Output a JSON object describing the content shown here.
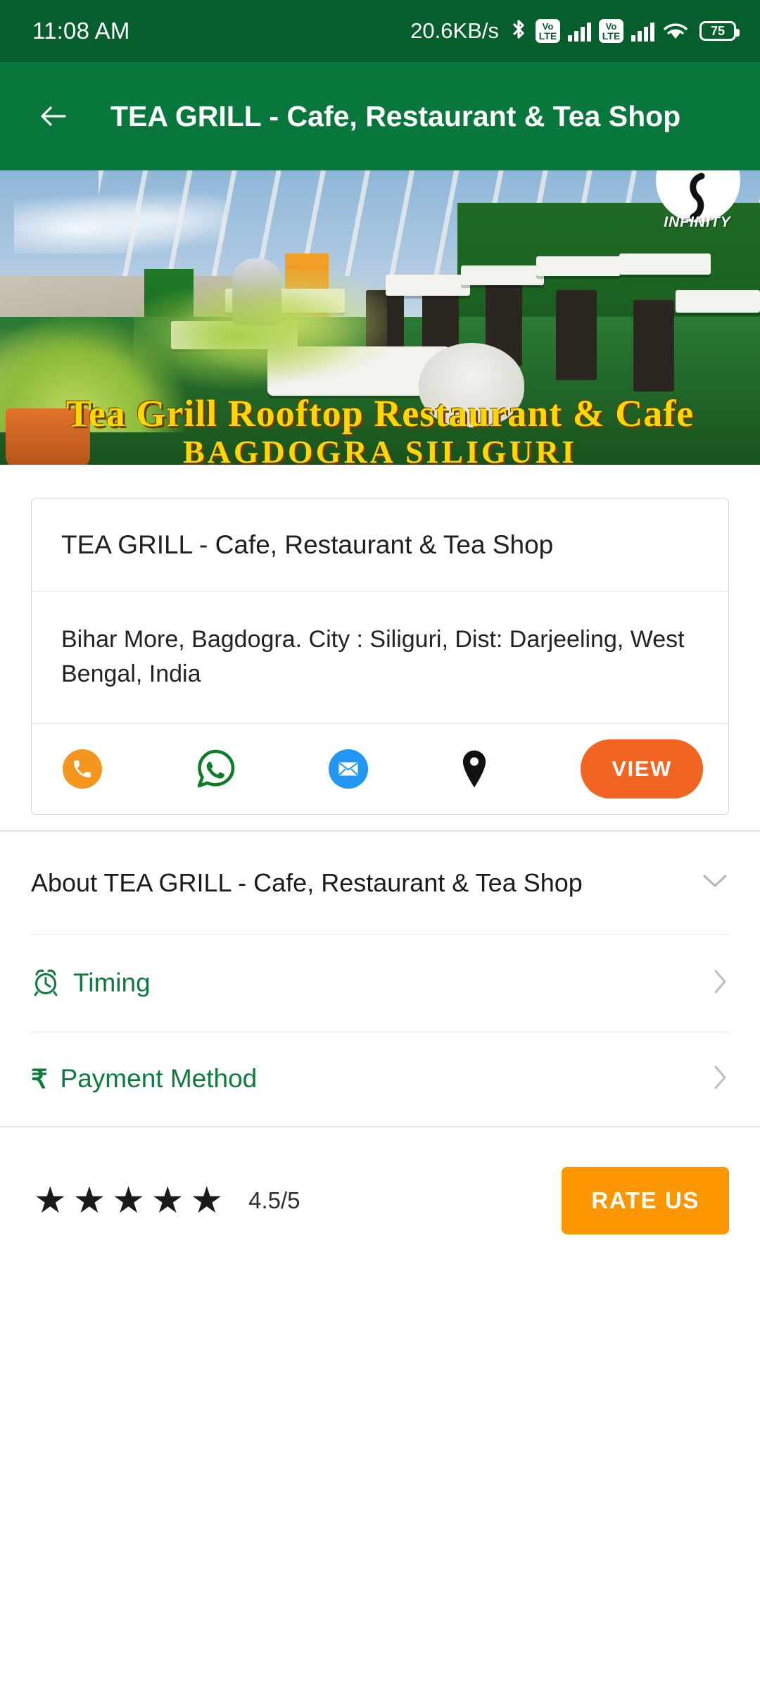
{
  "statusbar": {
    "time": "11:08 AM",
    "network_speed": "20.6KB/s",
    "volte_top": "Vo",
    "volte_bottom": "LTE",
    "battery_level": "75"
  },
  "appbar": {
    "back_label": "Back",
    "title": "TEA GRILL - Cafe, Restaurant & Tea Shop"
  },
  "banner": {
    "headline": "Tea Grill Rooftop Restaurant & Cafe",
    "subline": "BAGDOGRA  SILIGURI",
    "watermark": "INFINITY"
  },
  "card": {
    "name": "TEA GRILL - Cafe, Restaurant & Tea Shop",
    "address": "Bihar More, Bagdogra. City : Siliguri, Dist: Darjeeling, West Bengal, India",
    "actions": [
      {
        "name": "call",
        "icon": "phone-icon"
      },
      {
        "name": "whatsapp",
        "icon": "whatsapp-icon"
      },
      {
        "name": "email",
        "icon": "email-icon"
      },
      {
        "name": "location",
        "icon": "map-pin-icon"
      }
    ],
    "view_label": "VIEW"
  },
  "about": {
    "label": "About TEA GRILL - Cafe, Restaurant & Tea Shop",
    "chevron": "chevron-down-icon"
  },
  "list_rows": [
    {
      "label": "Timing",
      "icon": "alarm-clock-icon",
      "chevron": "chevron-right-icon"
    },
    {
      "label": "Payment Method",
      "icon": "rupee-icon",
      "symbol": "₹",
      "chevron": "chevron-right-icon"
    }
  ],
  "rating": {
    "stars_filled": 5,
    "star_glyph": "★",
    "value_text": "4.5/5",
    "rate_label": "RATE US"
  },
  "colors": {
    "status_bar": "#065E2C",
    "app_bar": "#07773C",
    "accent_green": "#0E7A3C",
    "view_orange": "#F26422",
    "rate_orange": "#FB9500",
    "call_orange": "#F5961E",
    "mail_blue": "#2196F3",
    "whatsapp_green": "#0B7C28"
  }
}
